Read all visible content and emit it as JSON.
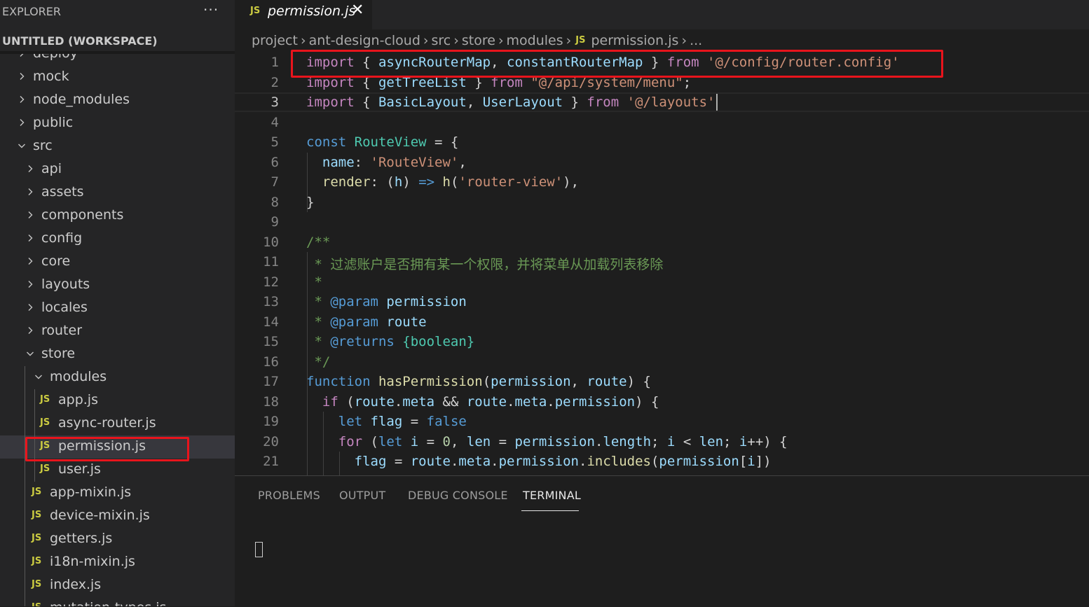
{
  "explorer": {
    "title": "EXPLORER",
    "more_icon": "ellipsis-icon",
    "more_label": "···",
    "workspace_title": "UNTITLED (WORKSPACE)"
  },
  "tree": [
    {
      "label": "deploy",
      "type": "folder",
      "expanded": false,
      "depth": 0
    },
    {
      "label": "mock",
      "type": "folder",
      "expanded": false,
      "depth": 0
    },
    {
      "label": "node_modules",
      "type": "folder",
      "expanded": false,
      "depth": 0
    },
    {
      "label": "public",
      "type": "folder",
      "expanded": false,
      "depth": 0
    },
    {
      "label": "src",
      "type": "folder",
      "expanded": true,
      "depth": 0
    },
    {
      "label": "api",
      "type": "folder",
      "expanded": false,
      "depth": 1
    },
    {
      "label": "assets",
      "type": "folder",
      "expanded": false,
      "depth": 1
    },
    {
      "label": "components",
      "type": "folder",
      "expanded": false,
      "depth": 1
    },
    {
      "label": "config",
      "type": "folder",
      "expanded": false,
      "depth": 1
    },
    {
      "label": "core",
      "type": "folder",
      "expanded": false,
      "depth": 1
    },
    {
      "label": "layouts",
      "type": "folder",
      "expanded": false,
      "depth": 1
    },
    {
      "label": "locales",
      "type": "folder",
      "expanded": false,
      "depth": 1
    },
    {
      "label": "router",
      "type": "folder",
      "expanded": false,
      "depth": 1
    },
    {
      "label": "store",
      "type": "folder",
      "expanded": true,
      "depth": 1
    },
    {
      "label": "modules",
      "type": "folder",
      "expanded": true,
      "depth": 2
    },
    {
      "label": "app.js",
      "type": "file",
      "depth": 3
    },
    {
      "label": "async-router.js",
      "type": "file",
      "depth": 3
    },
    {
      "label": "permission.js",
      "type": "file",
      "depth": 3,
      "selected": true
    },
    {
      "label": "user.js",
      "type": "file",
      "depth": 3
    },
    {
      "label": "app-mixin.js",
      "type": "file",
      "depth": 2
    },
    {
      "label": "device-mixin.js",
      "type": "file",
      "depth": 2
    },
    {
      "label": "getters.js",
      "type": "file",
      "depth": 2
    },
    {
      "label": "i18n-mixin.js",
      "type": "file",
      "depth": 2
    },
    {
      "label": "index.js",
      "type": "file",
      "depth": 2
    },
    {
      "label": "mutation-types.js",
      "type": "file",
      "depth": 2
    }
  ],
  "file_icon_label": "JS",
  "tab": {
    "label": "permission.js",
    "close_label": "✕"
  },
  "breadcrumb": {
    "segments": [
      "project",
      "ant-design-cloud",
      "src",
      "store",
      "modules"
    ],
    "file": "permission.js",
    "trailing": "..."
  },
  "editor": {
    "current_line": 3,
    "lines": [
      [
        [
          "kw2",
          "import"
        ],
        [
          "pun",
          " { "
        ],
        [
          "var",
          "asyncRouterMap"
        ],
        [
          "pun",
          ", "
        ],
        [
          "var",
          "constantRouterMap"
        ],
        [
          "pun",
          " } "
        ],
        [
          "kw2",
          "from"
        ],
        [
          "pun",
          " "
        ],
        [
          "str",
          "'@/config/router.config'"
        ]
      ],
      [
        [
          "kw2",
          "import"
        ],
        [
          "pun",
          " { "
        ],
        [
          "var",
          "getTreeList"
        ],
        [
          "pun",
          " } "
        ],
        [
          "kw2",
          "from"
        ],
        [
          "pun",
          " "
        ],
        [
          "str",
          "\"@/api/system/menu\""
        ],
        [
          "pun",
          ";"
        ]
      ],
      [
        [
          "kw2",
          "import"
        ],
        [
          "pun",
          " { "
        ],
        [
          "var",
          "BasicLayout"
        ],
        [
          "pun",
          ", "
        ],
        [
          "var",
          "UserLayout"
        ],
        [
          "pun",
          " } "
        ],
        [
          "kw2",
          "from"
        ],
        [
          "pun",
          " "
        ],
        [
          "str",
          "'@/layouts'"
        ]
      ],
      [],
      [
        [
          "kw",
          "const"
        ],
        [
          "pun",
          " "
        ],
        [
          "ty",
          "RouteView"
        ],
        [
          "pun",
          " = {"
        ]
      ],
      [
        [
          "pun",
          "  "
        ],
        [
          "var",
          "name"
        ],
        [
          "pun",
          ": "
        ],
        [
          "str",
          "'RouteView'"
        ],
        [
          "pun",
          ","
        ]
      ],
      [
        [
          "pun",
          "  "
        ],
        [
          "fn",
          "render"
        ],
        [
          "pun",
          ": ("
        ],
        [
          "var",
          "h"
        ],
        [
          "pun",
          ") "
        ],
        [
          "kw",
          "=>"
        ],
        [
          "pun",
          " "
        ],
        [
          "fn",
          "h"
        ],
        [
          "pun",
          "("
        ],
        [
          "str",
          "'router-view'"
        ],
        [
          "pun",
          "),"
        ]
      ],
      [
        [
          "pun",
          "}"
        ]
      ],
      [],
      [
        [
          "cm",
          "/**"
        ]
      ],
      [
        [
          "cm",
          " * 过滤账户是否拥有某一个权限，并将菜单从加载列表移除"
        ]
      ],
      [
        [
          "cm",
          " *"
        ]
      ],
      [
        [
          "cm",
          " * "
        ],
        [
          "kw",
          "@param"
        ],
        [
          "pun",
          " "
        ],
        [
          "var",
          "permission"
        ]
      ],
      [
        [
          "cm",
          " * "
        ],
        [
          "kw",
          "@param"
        ],
        [
          "pun",
          " "
        ],
        [
          "var",
          "route"
        ]
      ],
      [
        [
          "cm",
          " * "
        ],
        [
          "kw",
          "@returns"
        ],
        [
          "pun",
          " "
        ],
        [
          "ty",
          "{boolean}"
        ]
      ],
      [
        [
          "cm",
          " */"
        ]
      ],
      [
        [
          "kw",
          "function"
        ],
        [
          "pun",
          " "
        ],
        [
          "fn",
          "hasPermission"
        ],
        [
          "pun",
          "("
        ],
        [
          "var",
          "permission"
        ],
        [
          "pun",
          ", "
        ],
        [
          "var",
          "route"
        ],
        [
          "pun",
          ") {"
        ]
      ],
      [
        [
          "pun",
          "  "
        ],
        [
          "kw2",
          "if"
        ],
        [
          "pun",
          " ("
        ],
        [
          "var",
          "route"
        ],
        [
          "pun",
          "."
        ],
        [
          "var",
          "meta"
        ],
        [
          "pun",
          " && "
        ],
        [
          "var",
          "route"
        ],
        [
          "pun",
          "."
        ],
        [
          "var",
          "meta"
        ],
        [
          "pun",
          "."
        ],
        [
          "var",
          "permission"
        ],
        [
          "pun",
          ") {"
        ]
      ],
      [
        [
          "pun",
          "    "
        ],
        [
          "kw",
          "let"
        ],
        [
          "pun",
          " "
        ],
        [
          "var",
          "flag"
        ],
        [
          "pun",
          " = "
        ],
        [
          "kw",
          "false"
        ]
      ],
      [
        [
          "pun",
          "    "
        ],
        [
          "kw2",
          "for"
        ],
        [
          "pun",
          " ("
        ],
        [
          "kw",
          "let"
        ],
        [
          "pun",
          " "
        ],
        [
          "var",
          "i"
        ],
        [
          "pun",
          " = "
        ],
        [
          "num",
          "0"
        ],
        [
          "pun",
          ", "
        ],
        [
          "var",
          "len"
        ],
        [
          "pun",
          " = "
        ],
        [
          "var",
          "permission"
        ],
        [
          "pun",
          "."
        ],
        [
          "var",
          "length"
        ],
        [
          "pun",
          "; "
        ],
        [
          "var",
          "i"
        ],
        [
          "pun",
          " < "
        ],
        [
          "var",
          "len"
        ],
        [
          "pun",
          "; "
        ],
        [
          "var",
          "i"
        ],
        [
          "pun",
          "++) {"
        ]
      ],
      [
        [
          "pun",
          "      "
        ],
        [
          "var",
          "flag"
        ],
        [
          "pun",
          " = "
        ],
        [
          "var",
          "route"
        ],
        [
          "pun",
          "."
        ],
        [
          "var",
          "meta"
        ],
        [
          "pun",
          "."
        ],
        [
          "var",
          "permission"
        ],
        [
          "pun",
          "."
        ],
        [
          "fn",
          "includes"
        ],
        [
          "pun",
          "("
        ],
        [
          "var",
          "permission"
        ],
        [
          "pun",
          "["
        ],
        [
          "var",
          "i"
        ],
        [
          "pun",
          "])"
        ]
      ]
    ]
  },
  "panel": {
    "tabs": [
      "PROBLEMS",
      "OUTPUT",
      "DEBUG CONSOLE",
      "TERMINAL"
    ],
    "active_tab": "TERMINAL"
  },
  "colors": {
    "highlight": "#e8141c",
    "js_icon": "#cbcb41",
    "background": "#1e1e1e",
    "sidebar": "#252526"
  }
}
